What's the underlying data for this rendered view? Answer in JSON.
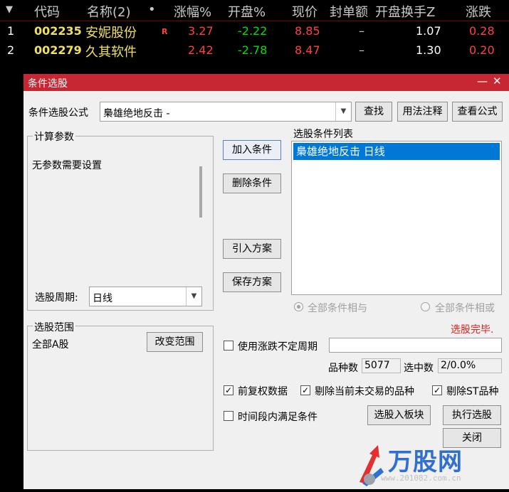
{
  "table": {
    "headers": {
      "menu_icon": "▼",
      "code": "代码",
      "name": "名称(2)",
      "dot": "•",
      "change_pct": "涨幅%",
      "open_pct": "开盘%",
      "price": "现价",
      "seal_amount": "封单额",
      "open_turnover": "开盘换手Z",
      "change": "涨跌"
    },
    "rows": [
      {
        "index": "1",
        "code": "002235",
        "name": "安妮股份",
        "flag": "R",
        "change_pct": "3.27",
        "open_pct": "-2.22",
        "price": "8.85",
        "seal_amount": "–",
        "open_turnover": "1.07",
        "change": "0.28"
      },
      {
        "index": "2",
        "code": "002279",
        "name": "久其软件",
        "flag": "",
        "change_pct": "2.42",
        "open_pct": "-2.78",
        "price": "8.47",
        "seal_amount": "–",
        "open_turnover": "1.30",
        "change": "0.20"
      }
    ]
  },
  "dialog": {
    "title": "条件选股",
    "min_icon": "—",
    "close_icon": "✕",
    "formula_label": "条件选股公式",
    "formula_value": "梟雄绝地反击 -",
    "find_button": "查找",
    "usage_button": "用法注释",
    "view_formula_button": "查看公式",
    "params_group": "计算参数",
    "params_text": "无参数需要设置",
    "period_label": "选股周期:",
    "period_value": "日线",
    "add_condition": "加入条件",
    "delete_condition": "删除条件",
    "import_scheme": "引入方案",
    "save_scheme": "保存方案",
    "conditions_label": "选股条件列表",
    "conditions": [
      "梟雄绝地反击  日线"
    ],
    "radio_and": "全部条件相与",
    "radio_or": "全部条件相或",
    "status": "选股完毕.",
    "scope_group": "选股范围",
    "scope_value": "全部A股",
    "change_scope": "改变范围",
    "use_indefinite_period": "使用涨跌不定周期",
    "count_label": "品种数",
    "count_value": "5077",
    "selected_label": "选中数",
    "selected_value": "2/0.0%",
    "checkbox_adjusted": "前复权数据",
    "checkbox_exclude_untraded": "剔除当前未交易的品种",
    "checkbox_exclude_st": "剔除ST品种",
    "checkbox_period_condition": "时间段内满足条件",
    "to_sector_button": "选股入板块",
    "execute_button": "执行选股",
    "close_button": "关闭"
  },
  "watermark": {
    "text": "万股网",
    "url": "www.201082.com.cn"
  },
  "colors": {
    "titlebar": "#c72733",
    "selection": "#0078d7",
    "status_red": "#e02020",
    "rise_red": "#ff4040",
    "fall_green": "#00e000",
    "code_yellow": "#f0e060"
  }
}
